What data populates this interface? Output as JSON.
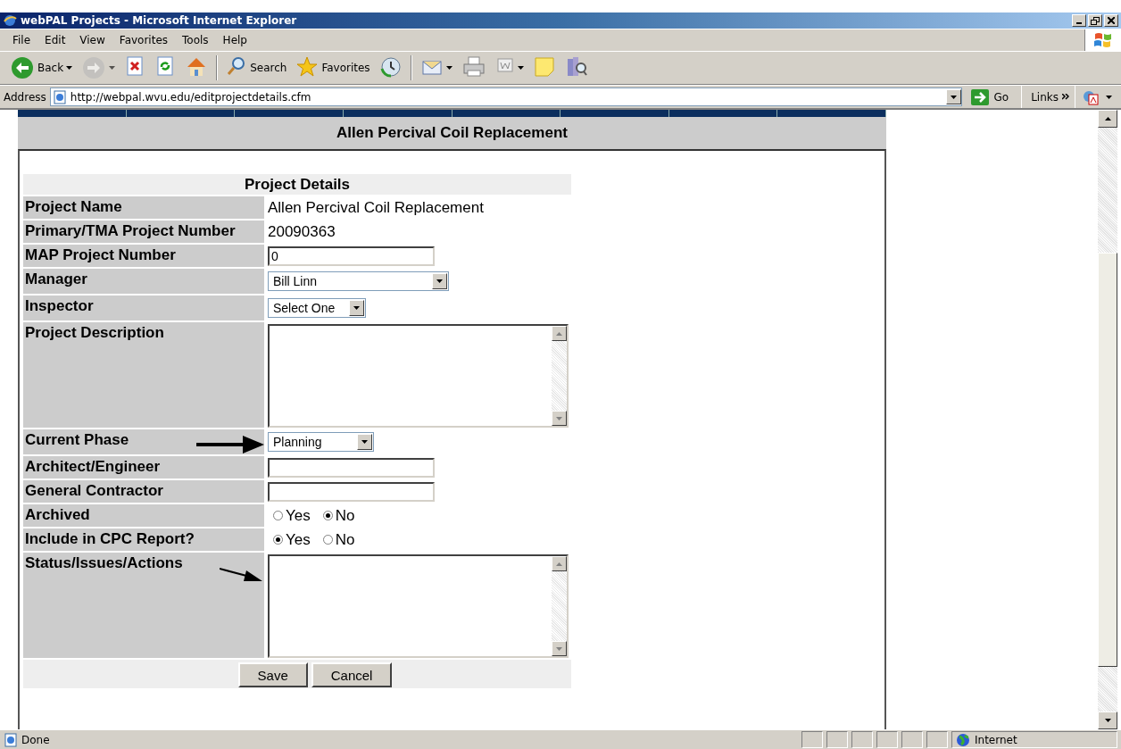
{
  "window": {
    "title": "webPAL Projects - Microsoft Internet Explorer"
  },
  "menu": [
    "File",
    "Edit",
    "View",
    "Favorites",
    "Tools",
    "Help"
  ],
  "toolbar": [
    {
      "kind": "back",
      "label": "Back",
      "dropdown": true
    },
    {
      "kind": "forward",
      "dropdown": true,
      "disabled": true
    },
    {
      "kind": "stop"
    },
    {
      "kind": "refresh"
    },
    {
      "kind": "home"
    },
    {
      "kind": "separator"
    },
    {
      "kind": "search",
      "label": "Search"
    },
    {
      "kind": "favorites",
      "label": "Favorites"
    },
    {
      "kind": "history"
    },
    {
      "kind": "separator"
    },
    {
      "kind": "mail",
      "dropdown": true
    },
    {
      "kind": "print"
    },
    {
      "kind": "edit",
      "dropdown": true
    },
    {
      "kind": "note"
    },
    {
      "kind": "research"
    }
  ],
  "address": {
    "label": "Address",
    "url": "http://webpal.wvu.edu/editprojectdetails.cfm",
    "go": "Go",
    "links": "Links"
  },
  "page": {
    "title": "Allen Percival Coil Replacement",
    "form": {
      "title": "Project Details",
      "fields": [
        {
          "label": "Project Name",
          "kind": "text",
          "value": "Allen Percival Coil Replacement"
        },
        {
          "label": "Primary/TMA Project Number",
          "kind": "text",
          "value": "20090363"
        },
        {
          "label": "MAP Project Number",
          "kind": "input",
          "value": "0"
        },
        {
          "label": "Manager",
          "kind": "select",
          "value": "Bill Linn"
        },
        {
          "label": "Inspector",
          "kind": "select",
          "value": "Select One"
        },
        {
          "label": "Project Description",
          "kind": "textarea"
        },
        {
          "label": "Current Phase",
          "kind": "select",
          "value": "Planning",
          "arrow": true,
          "bold_arrow": true
        },
        {
          "label": "Architect/Engineer",
          "kind": "input"
        },
        {
          "label": "General Contractor",
          "kind": "input"
        },
        {
          "label": "Archived",
          "kind": "radio",
          "options": [
            {
              "label": "Yes",
              "selected": false
            },
            {
              "label": "No",
              "selected": true
            }
          ]
        },
        {
          "label": "Include in CPC Report?",
          "kind": "radio",
          "options": [
            {
              "label": "Yes",
              "selected": true
            },
            {
              "label": "No",
              "selected": false
            }
          ]
        },
        {
          "label": "Status/Issues/Actions",
          "kind": "textarea",
          "arrow": true,
          "bold_arrow": false
        }
      ],
      "buttons": [
        "Save",
        "Cancel"
      ]
    }
  },
  "status_bar": {
    "text": "Done",
    "zone": "Internet"
  }
}
